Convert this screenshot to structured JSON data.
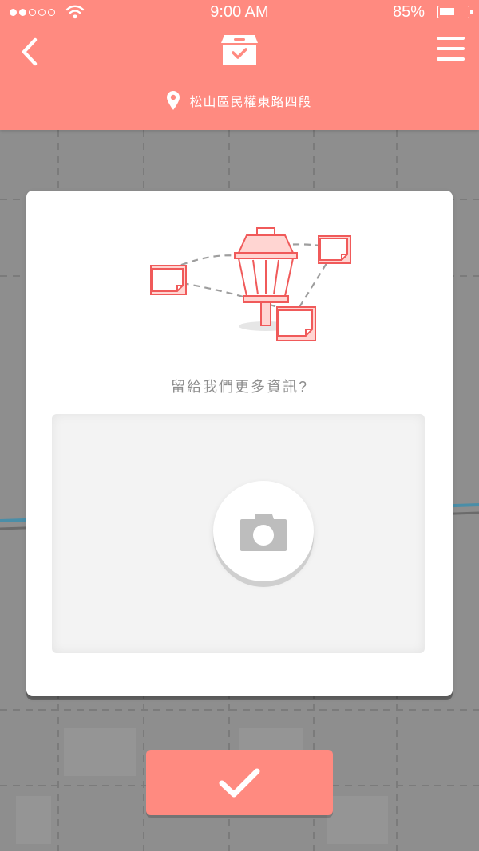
{
  "status_bar": {
    "signal_dots_filled": 2,
    "signal_dots_total": 5,
    "wifi_icon": "wifi-icon",
    "time": "9:00  AM",
    "battery_percent": "85%",
    "battery_level": 0.55
  },
  "header": {
    "back_icon": "chevron-left-icon",
    "logo_icon": "box-check-icon",
    "menu_icon": "hamburger-icon",
    "location_icon": "map-pin-icon",
    "location_text": "松山區民權東路四段"
  },
  "card": {
    "illustration": "street-lamp-with-notes",
    "question": "留給我們更多資訊?",
    "upload_icon": "camera-icon"
  },
  "confirm": {
    "icon": "check-icon"
  },
  "colors": {
    "accent": "#ff8a80",
    "accent_dark": "#f05a5a",
    "map_bg": "#8e8e8e",
    "card_bg": "#ffffff",
    "upload_bg": "#f3f3f3",
    "text_muted": "#8d8d8d",
    "camera_gray": "#bdbdbd"
  }
}
